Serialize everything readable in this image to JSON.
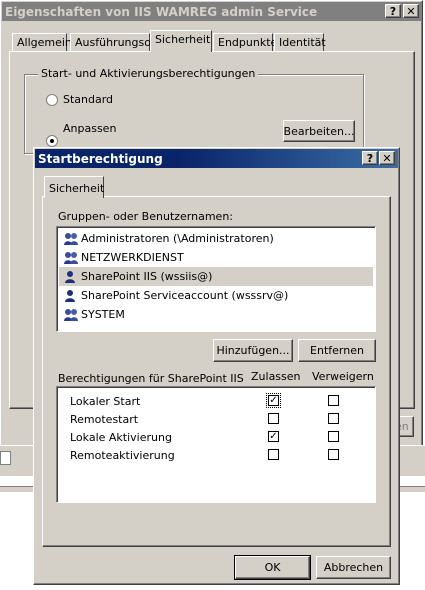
{
  "back_window": {
    "title": "Eigenschaften von IIS WAMREG admin Service",
    "tabs": [
      "Allgemein",
      "Ausführungsort",
      "Sicherheit",
      "Endpunkte",
      "Identität"
    ],
    "active_tab": "Sicherheit",
    "group_title": "Start- und Aktivierungsberechtigungen",
    "radio_standard": "Standard",
    "radio_custom": "Anpassen",
    "selected_radio": "Anpassen",
    "edit_button": "Bearbeiten...",
    "partial_button": "en"
  },
  "dialog": {
    "title": "Startberechtigung",
    "help_glyph": "?",
    "close_glyph": "✕",
    "tab": "Sicherheit",
    "users_label": "Gruppen- oder Benutzernamen:",
    "users": [
      {
        "name": "Administratoren (\\Administratoren)",
        "icon": "group-icon"
      },
      {
        "name": "NETZWERKDIENST",
        "icon": "group-icon"
      },
      {
        "name": "SharePoint IIS (wssiis@)",
        "icon": "user-icon",
        "selected": true
      },
      {
        "name": "SharePoint Serviceaccount (wsssrv@)",
        "icon": "user-icon"
      },
      {
        "name": "SYSTEM",
        "icon": "group-icon"
      }
    ],
    "add_button": "Hinzufügen...",
    "remove_button": "Entfernen",
    "perm_label": "Berechtigungen für SharePoint IIS",
    "col_allow": "Zulassen",
    "col_deny": "Verweigern",
    "permissions": [
      {
        "name": "Lokaler Start",
        "allow": true,
        "deny": false
      },
      {
        "name": "Remotestart",
        "allow": false,
        "deny": false
      },
      {
        "name": "Lokale Aktivierung",
        "allow": true,
        "deny": false
      },
      {
        "name": "Remoteaktivierung",
        "allow": false,
        "deny": false
      }
    ],
    "ok_button": "OK",
    "cancel_button": "Abbrechen"
  }
}
